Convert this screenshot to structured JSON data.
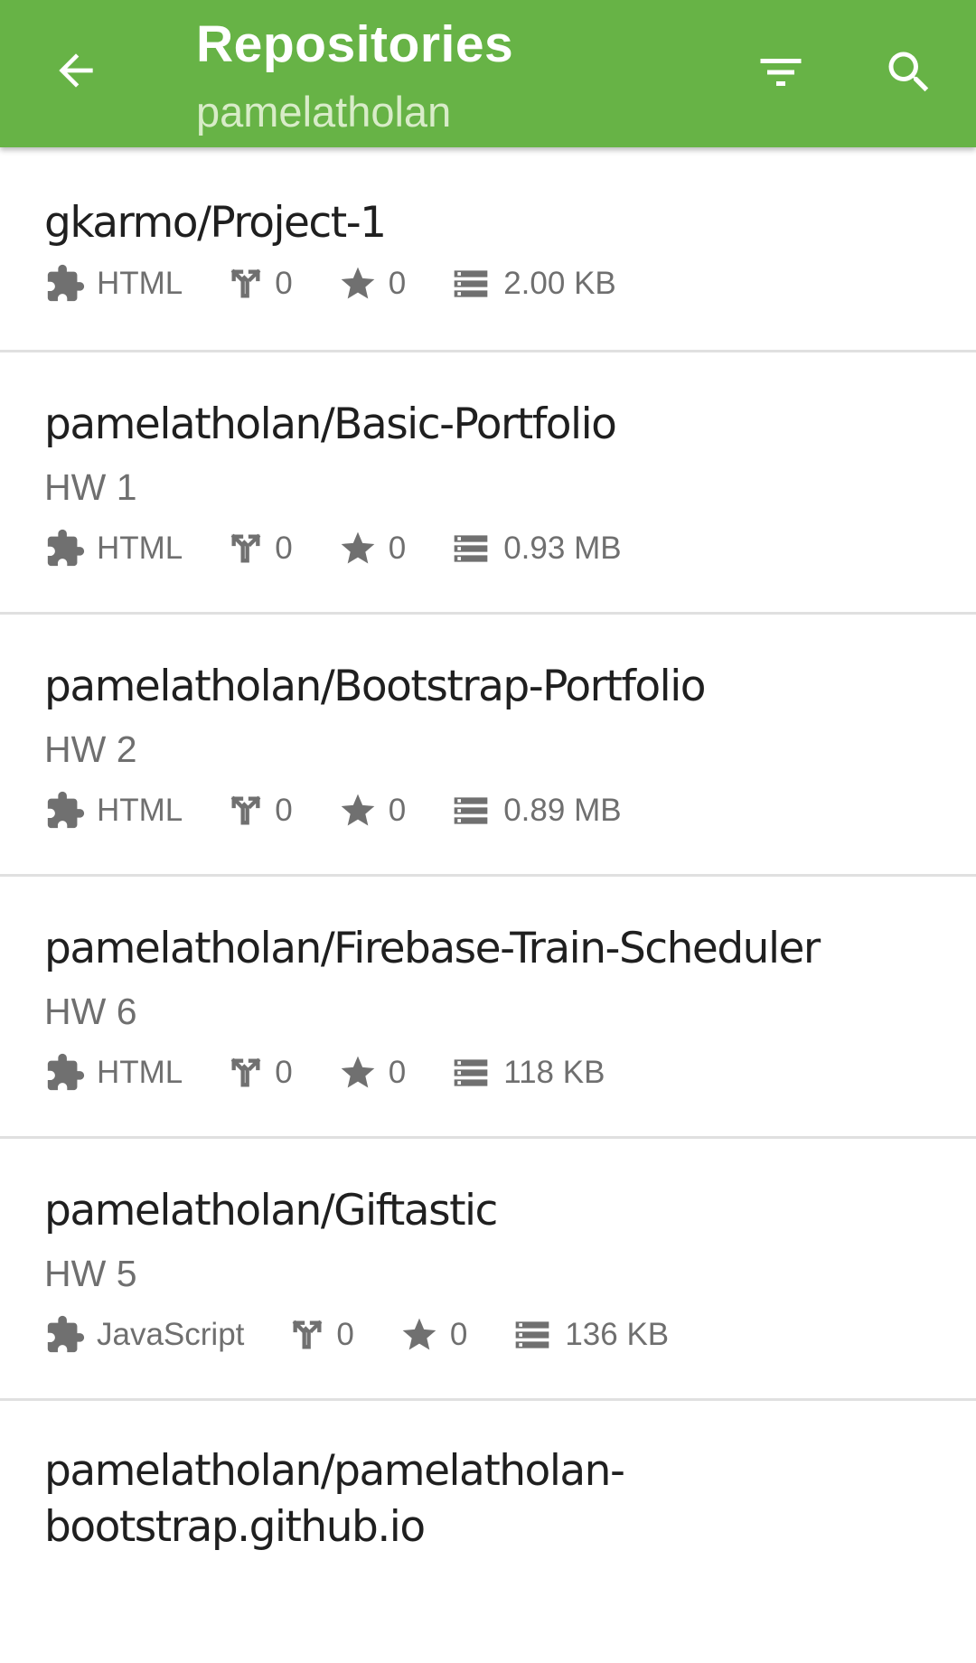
{
  "appbar": {
    "title": "Repositories",
    "subtitle": "pamelatholan",
    "back_icon": "arrow-back-icon",
    "filter_icon": "filter-icon",
    "search_icon": "search-icon",
    "color": "#67b346"
  },
  "repos": [
    {
      "name": "gkarmo/Project-1",
      "description": "",
      "language": "HTML",
      "forks": "0",
      "stars": "0",
      "size": "2.00 KB"
    },
    {
      "name": "pamelatholan/Basic-Portfolio",
      "description": "HW 1",
      "language": "HTML",
      "forks": "0",
      "stars": "0",
      "size": "0.93 MB"
    },
    {
      "name": "pamelatholan/Bootstrap-Portfolio",
      "description": "HW 2",
      "language": "HTML",
      "forks": "0",
      "stars": "0",
      "size": "0.89 MB"
    },
    {
      "name": "pamelatholan/Firebase-Train-Scheduler",
      "description": "HW 6",
      "language": "HTML",
      "forks": "0",
      "stars": "0",
      "size": "118 KB"
    },
    {
      "name": "pamelatholan/Giftastic",
      "description": "HW 5",
      "language": "JavaScript",
      "forks": "0",
      "stars": "0",
      "size": "136 KB"
    },
    {
      "name_line1": "pamelatholan/pamelatholan-",
      "name_line2": "bootstrap.github.io"
    }
  ]
}
